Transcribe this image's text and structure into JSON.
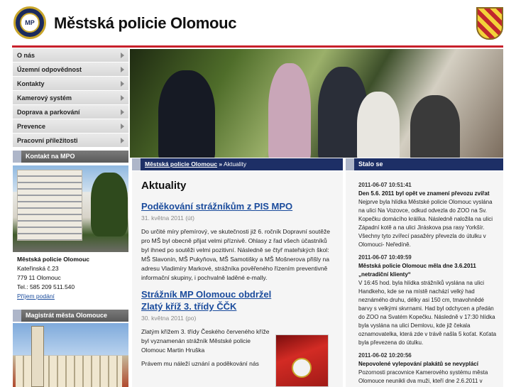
{
  "header": {
    "title": "Městská policie Olomouc",
    "logo_text": "MP"
  },
  "nav": {
    "items": [
      {
        "label": "O nás"
      },
      {
        "label": "Územní odpovědnost"
      },
      {
        "label": "Kontakty"
      },
      {
        "label": "Kamerový systém"
      },
      {
        "label": "Doprava a parkování"
      },
      {
        "label": "Prevence"
      },
      {
        "label": "Pracovní příležitosti"
      }
    ]
  },
  "sidebar": {
    "contact_heading": "Kontakt na MPO",
    "address": {
      "name": "Městská policie Olomouc",
      "street": "Kateřinská č.23",
      "city": "779 11 Olomouc",
      "phone": "Tel.: 585 209 511.540",
      "link": "Příjem podání"
    },
    "magistrat_heading": "Magistrát města Olomouce"
  },
  "breadcrumb": {
    "home": "Městská policie Olomouc",
    "separator": "»",
    "current": "Aktuality"
  },
  "main": {
    "heading": "Aktuality",
    "articles": [
      {
        "title": "Poděkování strážníkům z PIS MPO",
        "date": "31. května 2011 (út)",
        "text": "Do určité míry přemírový, ve skutečnosti již 6. ročník Dopravní soutěže pro MŠ byl obecně přijat velmi příznivě. Ohlasy z řad všech účastníků byl ihned po soutěži velmi pozitivní. Následně se čtyř mateřských škol: MŠ Slavonín, MŠ Pukyňova, MŠ Samotišky a MŠ Mošnerova přišly na adresu Vladimíry Markové, strážníka pověřeného řízením preventivně informační skupiny, i pochvalně laděné e-mally."
      },
      {
        "title": "Strážník MP Olomouc obdržel Zlatý kříž 3. třídy ČČK",
        "date": "30. května 2011 (po)",
        "text": "Zlatým křížem 3. třídy Českého červeného kříže byl vyznamenán strážník Městské policie Olomouc Martin Hruška",
        "text2": "Právem mu náleží uznání a poděkování nás"
      }
    ]
  },
  "stalo": {
    "heading": "Stalo se",
    "items": [
      {
        "date": "2011-06-07 10:51:41",
        "headline": "Den 5.6. 2011 byl opět ve znamení převozu zvířat",
        "text": "Nejprve byla hlídka Městské policie Olomouc vyslána na ulici Na Vozovce, odkud odvezla do ZOO na Sv. Kopečku domácího králíka. Následně naložila na ulici Západní kotě a na ulici Jiráskova psa rasy Yorkšír. Všechny tyto zvířecí pasažéry převezla do útulku v Olomouci- Neředíně."
      },
      {
        "date": "2011-06-07 10:49:59",
        "headline": "Městská policie Olomouc měla dne 3.6.2011 „netradiční klienty“",
        "text": "V 16:45 hod. byla hlídka strážníků vyslána na ulici Handkeho, kde se na místě nachází velký had neznámého druhu, délky asi 150 cm, tmavohnědé barvy s velkými skvrnami. Had byl odchycen a předán do ZOO na Svatém Kopečku. Následně v 17:30 hlídka byla vyslána na ulici Demlovu, kde již čekala oznamovatelka, která zde v trávě našla 5 koťat. Koťata byla převezena do útulku."
      },
      {
        "date": "2011-06-02 10:20:56",
        "headline": "Nepovolené vylepování plakátů se nevyplácí",
        "text": "Pozornosti pracovnice Kamerového systému města Olomouce neunikli dva muži, kteří dne 2.6.2011 v"
      }
    ]
  },
  "colors": {
    "accent_red": "#c8202b",
    "nav_dark": "#1d2f66",
    "link_blue": "#1a4b9c"
  }
}
